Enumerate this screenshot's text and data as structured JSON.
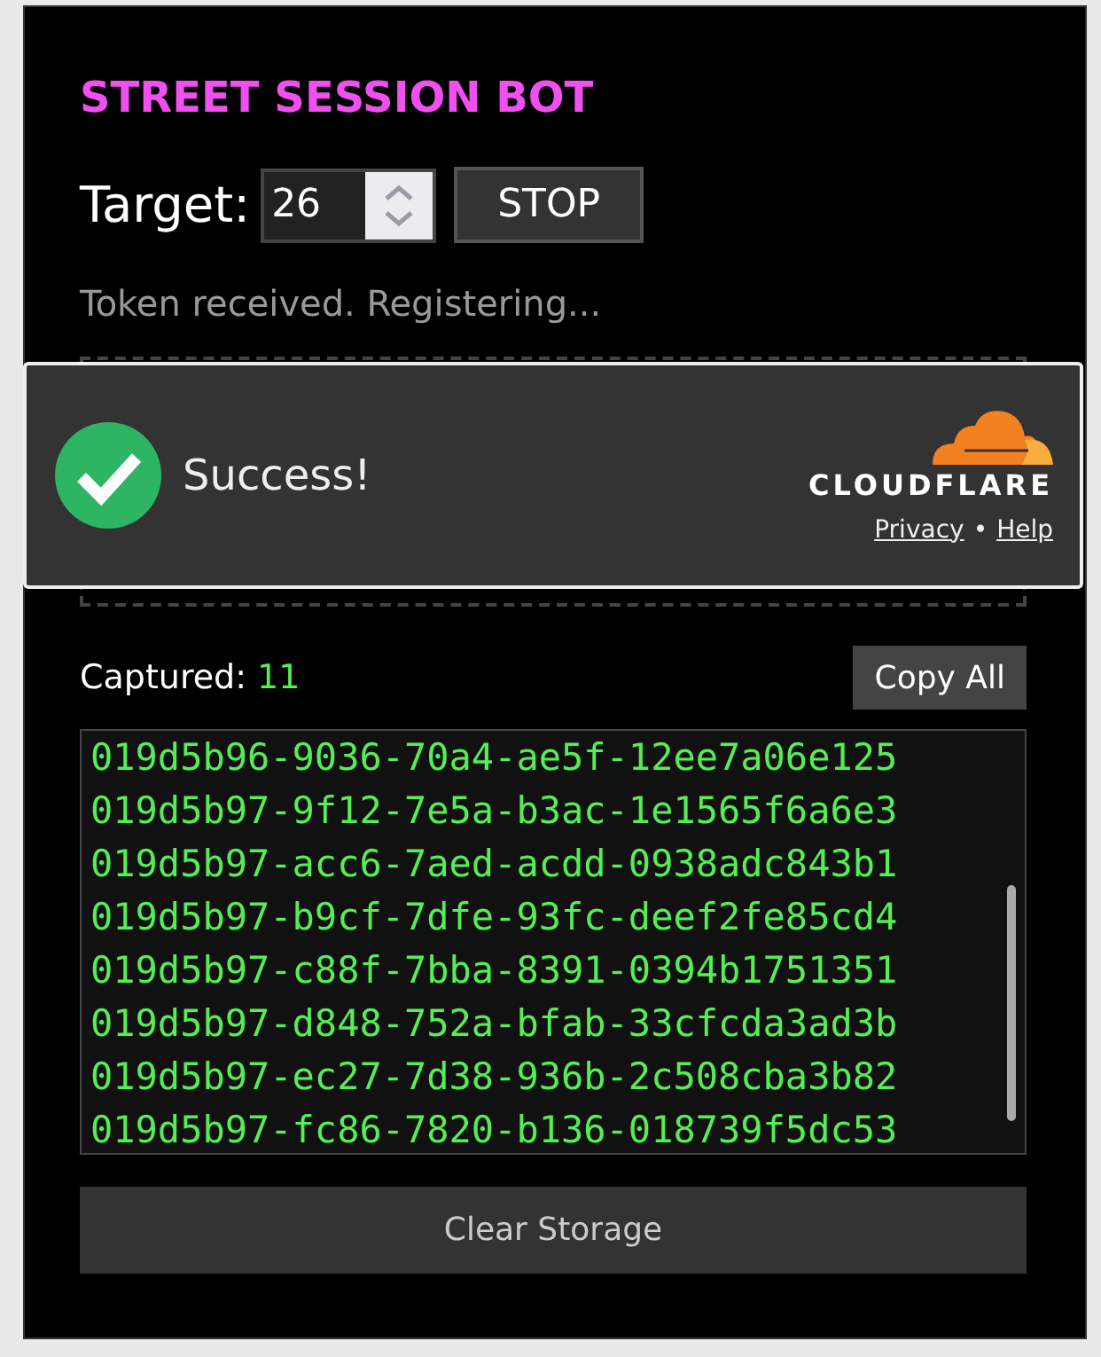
{
  "title": "STREET SESSION BOT",
  "target": {
    "label": "Target:",
    "value": "26"
  },
  "stop_button": "STOP",
  "status": "Token received. Registering...",
  "challenge": {
    "message": "Success!",
    "brand": "CLOUDFLARE",
    "links": [
      "Privacy",
      "Help"
    ],
    "separator": "•"
  },
  "captured": {
    "label": "Captured:",
    "count": "11"
  },
  "copy_button": "Copy All",
  "tokens": [
    "019d5b96-9036-70a4-ae5f-12ee7a06e125",
    "019d5b97-9f12-7e5a-b3ac-1e1565f6a6e3",
    "019d5b97-acc6-7aed-acdd-0938adc843b1",
    "019d5b97-b9cf-7dfe-93fc-deef2fe85cd4",
    "019d5b97-c88f-7bba-8391-0394b1751351",
    "019d5b97-d848-752a-bfab-33cfcda3ad3b",
    "019d5b97-ec27-7d38-936b-2c508cba3b82",
    "019d5b97-fc86-7820-b136-018739f5dc53"
  ],
  "clear_button": "Clear Storage"
}
